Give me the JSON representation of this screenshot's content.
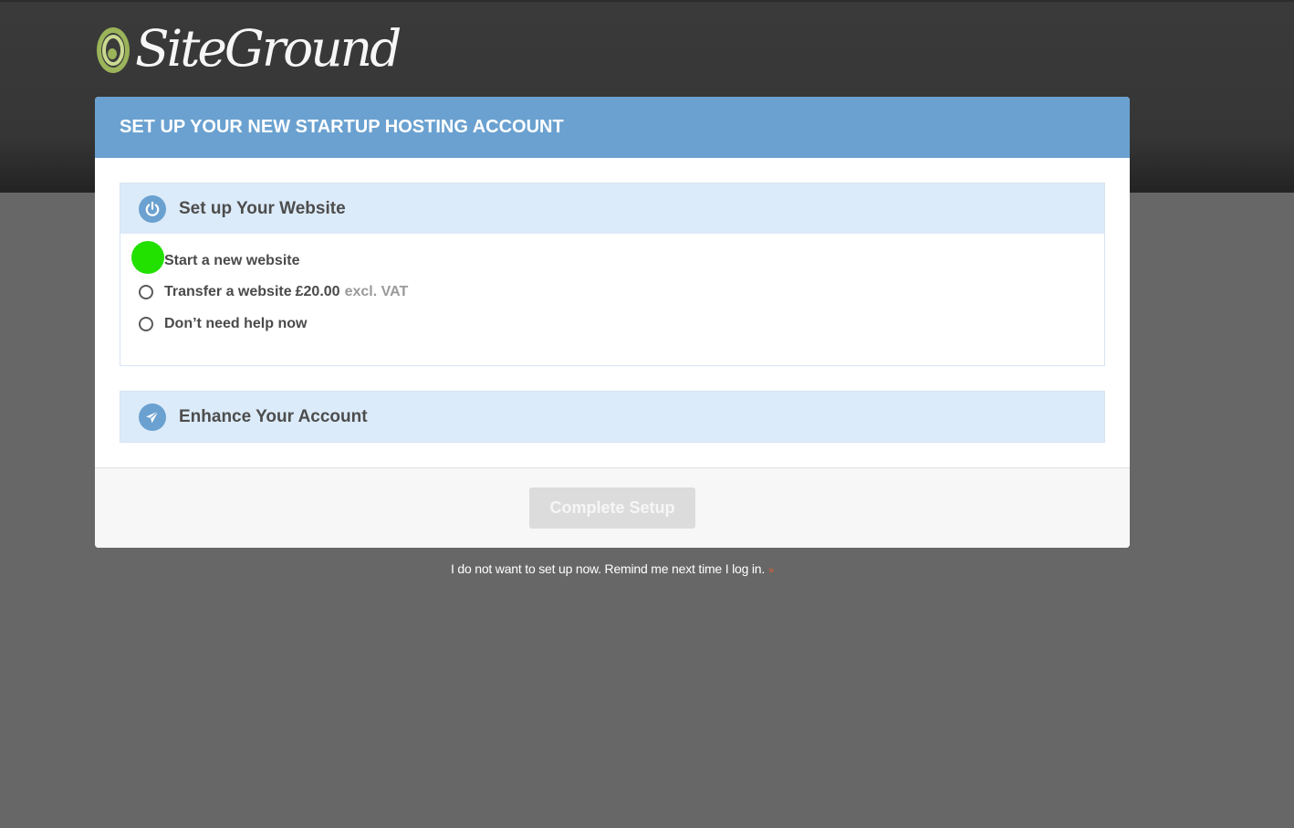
{
  "brand": {
    "name": "SiteGround"
  },
  "card": {
    "title": "SET UP YOUR NEW STARTUP HOSTING ACCOUNT"
  },
  "setup_section": {
    "title": "Set up Your Website",
    "icon": "power-icon",
    "options": [
      {
        "label": "Start a new website",
        "selected": true
      },
      {
        "label": "Transfer a website",
        "price": "£20.00",
        "note": "excl. VAT",
        "selected": false
      },
      {
        "label": "Don’t need help now",
        "selected": false
      }
    ]
  },
  "enhance_section": {
    "title": "Enhance Your Account",
    "icon": "paper-plane-icon"
  },
  "actions": {
    "complete_label": "Complete Setup"
  },
  "remind": {
    "text": "I do not want to set up now. Remind me next time I log in.",
    "arrow": "»"
  },
  "colors": {
    "header_blue": "#6aa1d0",
    "section_bg": "#dcebf9",
    "marker_green": "#22e000",
    "remind_arrow": "#e85b2a"
  }
}
